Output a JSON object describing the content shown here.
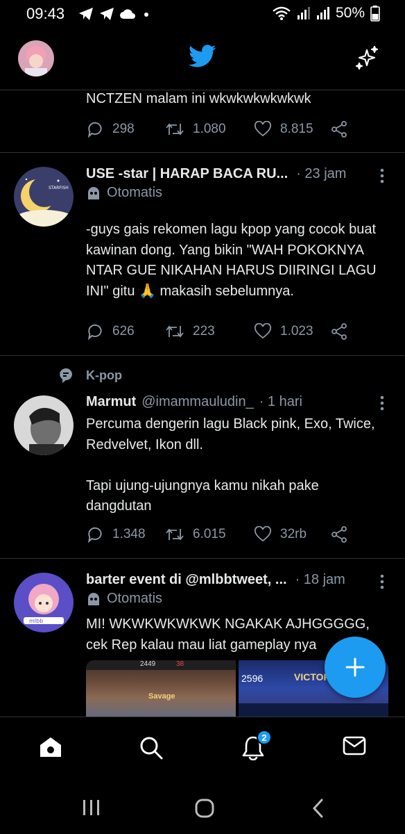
{
  "status_bar": {
    "time": "09:43",
    "battery_text": "50%",
    "left_icons": [
      "telegram-icon",
      "telegram-icon",
      "cloud-icon",
      "dot-icon"
    ],
    "right_icons": [
      "wifi-icon",
      "signal-icon",
      "signal-icon",
      "battery-icon"
    ]
  },
  "header": {
    "logo_icon": "twitter-bird-icon",
    "sparkle_icon": "sparkle-icon",
    "accent_color": "#1d9bf0"
  },
  "tweets": [
    {
      "text": "NCTZEN malam ini wkwkwkwkwkwk",
      "replies": "298",
      "retweets": "1.080",
      "likes": "8.815"
    },
    {
      "name": "USE -star | HARAP BACA RU...",
      "time": "· 23 jam",
      "automated_label": "Otomatis",
      "text": "-guys gais rekomen lagu kpop yang cocok buat kawinan dong. Yang bikin \"WAH POKOKNYA NTAR GUE NIKAHAN HARUS DIIRINGI LAGU INI\" gitu 🙏 makasih sebelumnya.",
      "replies": "626",
      "retweets": "223",
      "likes": "1.023"
    },
    {
      "topic": "K-pop",
      "name": "Marmut",
      "handle": "@imammauludin_",
      "time": "· 1 hari",
      "text": "Percuma dengerin lagu Black pink, Exo, Twice, Redvelvet, Ikon dll.\n\nTapi ujung-ujungnya kamu nikah pake dangdutan",
      "replies": "1.348",
      "retweets": "6.015",
      "likes": "32rb"
    },
    {
      "name": "barter event di @mlbbtweet, ...",
      "time": "· 18 jam",
      "automated_label": "Otomatis",
      "text": "MI! WKWKWKWKWK NGAKAK AJHGGGGG, cek Rep kalau mau liat gameplay nya",
      "media_left_text": "Savage",
      "media_right_text": "VICTORY",
      "media_right_number": "2596",
      "media_left_numbers": [
        "2449",
        "38"
      ]
    }
  ],
  "bottom_nav": {
    "items": [
      "home-icon",
      "search-icon",
      "notifications-icon",
      "messages-icon"
    ],
    "notification_badge": "2"
  },
  "system_nav": [
    "recents-icon",
    "home-circle-icon",
    "back-icon"
  ]
}
